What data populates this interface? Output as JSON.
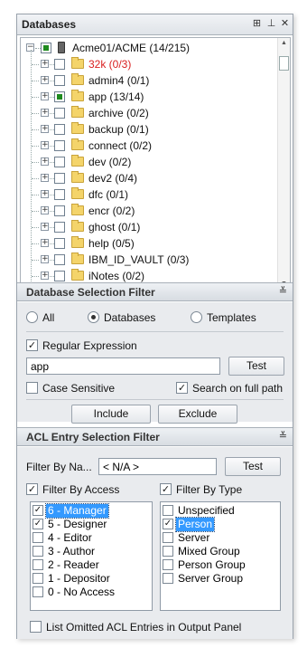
{
  "panel": {
    "title": "Databases",
    "title_buttons": [
      "⊞",
      "⊥",
      "✕"
    ]
  },
  "tree": {
    "root": {
      "label": "Acme01/ACME  (14/215)",
      "check": "partial"
    },
    "items": [
      {
        "label": "32k  (0/3)",
        "red": true,
        "checked": false
      },
      {
        "label": "admin4  (0/1)",
        "red": false,
        "checked": false
      },
      {
        "label": "app  (13/14)",
        "red": false,
        "checked": true
      },
      {
        "label": "archive  (0/2)",
        "red": false,
        "checked": false
      },
      {
        "label": "backup  (0/1)",
        "red": false,
        "checked": false
      },
      {
        "label": "connect  (0/2)",
        "red": false,
        "checked": false
      },
      {
        "label": "dev  (0/2)",
        "red": false,
        "checked": false
      },
      {
        "label": "dev2  (0/4)",
        "red": false,
        "checked": false
      },
      {
        "label": "dfc  (0/1)",
        "red": false,
        "checked": false
      },
      {
        "label": "encr  (0/2)",
        "red": false,
        "checked": false
      },
      {
        "label": "ghost  (0/1)",
        "red": false,
        "checked": false
      },
      {
        "label": "help  (0/5)",
        "red": false,
        "checked": false
      },
      {
        "label": "IBM_ID_VAULT  (0/3)",
        "red": false,
        "checked": false
      },
      {
        "label": "iNotes  (0/2)",
        "red": false,
        "checked": false
      }
    ]
  },
  "db_filter": {
    "header": "Database Selection Filter",
    "radio_all": "All",
    "radio_databases": "Databases",
    "radio_templates": "Templates",
    "regex_label": "Regular Expression",
    "regex_value": "app",
    "test_label": "Test",
    "case_sensitive_label": "Case Sensitive",
    "full_path_label": "Search on full path",
    "include_label": "Include",
    "exclude_label": "Exclude"
  },
  "acl_filter": {
    "header": "ACL Entry Selection Filter",
    "filter_by_name_label": "Filter By Na...",
    "filter_by_name_value": "< N/A >",
    "test_label": "Test",
    "filter_by_access_label": "Filter By Access",
    "filter_by_type_label": "Filter By Type",
    "access_items": [
      {
        "label": "6 - Manager",
        "checked": true,
        "selected": true
      },
      {
        "label": "5 - Designer",
        "checked": true,
        "selected": false
      },
      {
        "label": "4 - Editor",
        "checked": false,
        "selected": false
      },
      {
        "label": "3 - Author",
        "checked": false,
        "selected": false
      },
      {
        "label": "2 - Reader",
        "checked": false,
        "selected": false
      },
      {
        "label": "1 - Depositor",
        "checked": false,
        "selected": false
      },
      {
        "label": "0 - No Access",
        "checked": false,
        "selected": false
      }
    ],
    "type_items": [
      {
        "label": "Unspecified",
        "checked": false,
        "selected": false
      },
      {
        "label": "Person",
        "checked": true,
        "selected": true
      },
      {
        "label": "Server",
        "checked": false,
        "selected": false
      },
      {
        "label": "Mixed Group",
        "checked": false,
        "selected": false
      },
      {
        "label": "Person Group",
        "checked": false,
        "selected": false
      },
      {
        "label": "Server Group",
        "checked": false,
        "selected": false
      }
    ],
    "list_omitted_label": "List Omitted ACL Entries in Output Panel"
  }
}
